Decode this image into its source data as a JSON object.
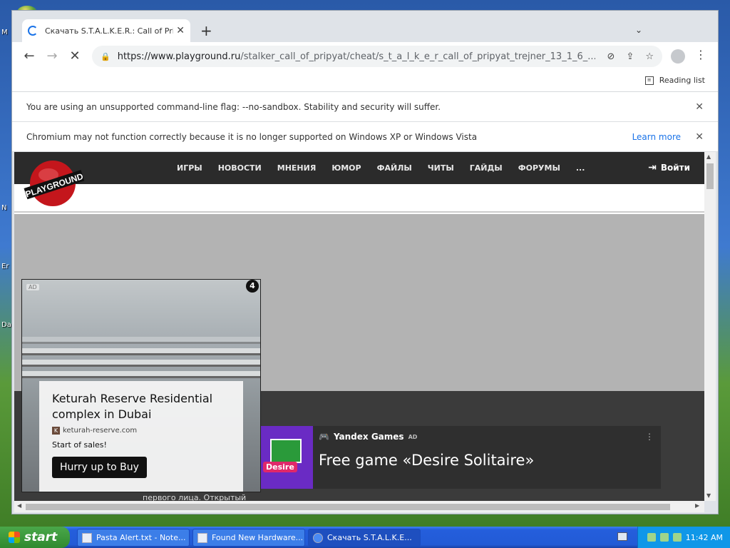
{
  "desktop": {
    "labels": [
      "M",
      "N",
      "Er",
      "Da"
    ]
  },
  "window": {
    "controls": [
      "▁",
      "□",
      "✕"
    ]
  },
  "browser": {
    "tab_title": "Скачать S.T.A.L.K.E.R.: Call of Pripyat",
    "tab_close": "✕",
    "new_tab": "+",
    "tab_menu": "⌄",
    "nav": {
      "back": "←",
      "forward": "→",
      "stop": "✕"
    },
    "url_host": "https://www.playground.ru",
    "url_path": "/stalker_call_of_pripyat/cheat/s_t_a_l_k_e_r_call_of_pripyat_trejner_13_1_6_...",
    "reading_list": "Reading list",
    "more": "⋮"
  },
  "infobars": [
    {
      "text": "You are using an unsupported command-line flag: --no-sandbox. Stability and security will suffer.",
      "close": "✕"
    },
    {
      "text": "Chromium may not function correctly because it is no longer supported on Windows XP or Windows Vista",
      "link": "Learn more",
      "close": "✕"
    }
  ],
  "site": {
    "logo": "PLAYGROUND",
    "nav_items": [
      "ИГРЫ",
      "НОВОСТИ",
      "МНЕНИЯ",
      "ЮМОР",
      "ФАЙЛЫ",
      "ЧИТЫ",
      "ГАЙДЫ",
      "ФОРУМЫ",
      "..."
    ],
    "login": "Войти",
    "body_text": "первого лица. Открытый"
  },
  "yandex_ad": {
    "brand": "Yandex Games",
    "ad_label": "AD",
    "title": "Free game «Desire Solitaire»",
    "thumb_text": "Desire",
    "menu": "⋮"
  },
  "overlay_ad": {
    "label": "AD",
    "counter": "4",
    "headline": "Keturah Reserve Residential complex in Dubai",
    "domain": "keturah-reserve.com",
    "domain_icon": "K",
    "description": "Start of sales!",
    "cta": "Hurry up to Buy"
  },
  "taskbar": {
    "start": "start",
    "buttons": [
      "Pasta Alert.txt - Note...",
      "Found New Hardware...",
      "Скачать S.T.A.L.K.E..."
    ],
    "clock": "11:42 AM"
  },
  "colors": {
    "accent": "#1a73e8",
    "site_header": "#2b2b2b",
    "taskbar": "#245edc"
  }
}
